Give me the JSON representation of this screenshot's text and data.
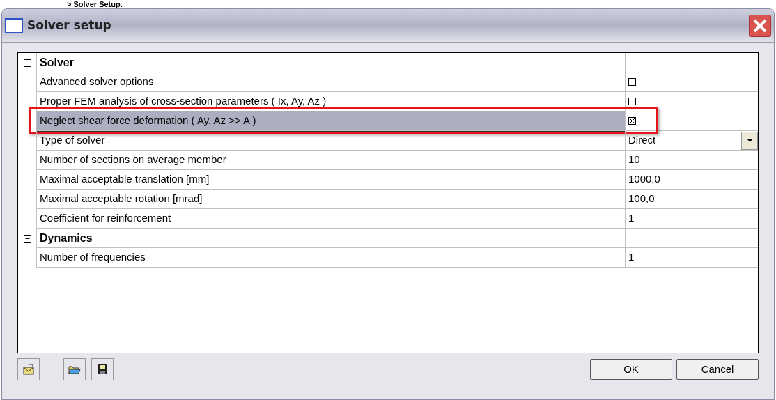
{
  "caption": "> Solver Setup.",
  "window": {
    "title": "Solver setup"
  },
  "grid": {
    "rows": [
      {
        "kind": "group",
        "label": "Solver",
        "expanded": true,
        "selected": false,
        "highlighted": false
      },
      {
        "kind": "check",
        "label": "Advanced solver options",
        "checked": false,
        "selected": false,
        "highlighted": false
      },
      {
        "kind": "check",
        "label": "Proper FEM analysis of cross-section parameters ( Ix, Ay, Az )",
        "checked": false,
        "selected": false,
        "highlighted": false
      },
      {
        "kind": "check",
        "label": "Neglect shear force deformation ( Ay, Az >> A )",
        "checked": true,
        "selected": true,
        "highlighted": true
      },
      {
        "kind": "dropdown",
        "label": "Type of solver",
        "value": "Direct",
        "selected": false,
        "highlighted": false
      },
      {
        "kind": "text",
        "label": "Number of sections on average member",
        "value": "10",
        "selected": false,
        "highlighted": false
      },
      {
        "kind": "text",
        "label": "Maximal acceptable translation [mm]",
        "value": "1000,0",
        "selected": false,
        "highlighted": false
      },
      {
        "kind": "text",
        "label": "Maximal acceptable rotation [mrad]",
        "value": "100,0",
        "selected": false,
        "highlighted": false
      },
      {
        "kind": "text",
        "label": "Coefficient for reinforcement",
        "value": "1",
        "selected": false,
        "highlighted": false
      },
      {
        "kind": "group",
        "label": "Dynamics",
        "expanded": true,
        "selected": false,
        "highlighted": false
      },
      {
        "kind": "text",
        "label": "Number of frequencies",
        "value": "1",
        "selected": false,
        "highlighted": false
      }
    ]
  },
  "buttons": [
    "OK",
    "Cancel"
  ]
}
